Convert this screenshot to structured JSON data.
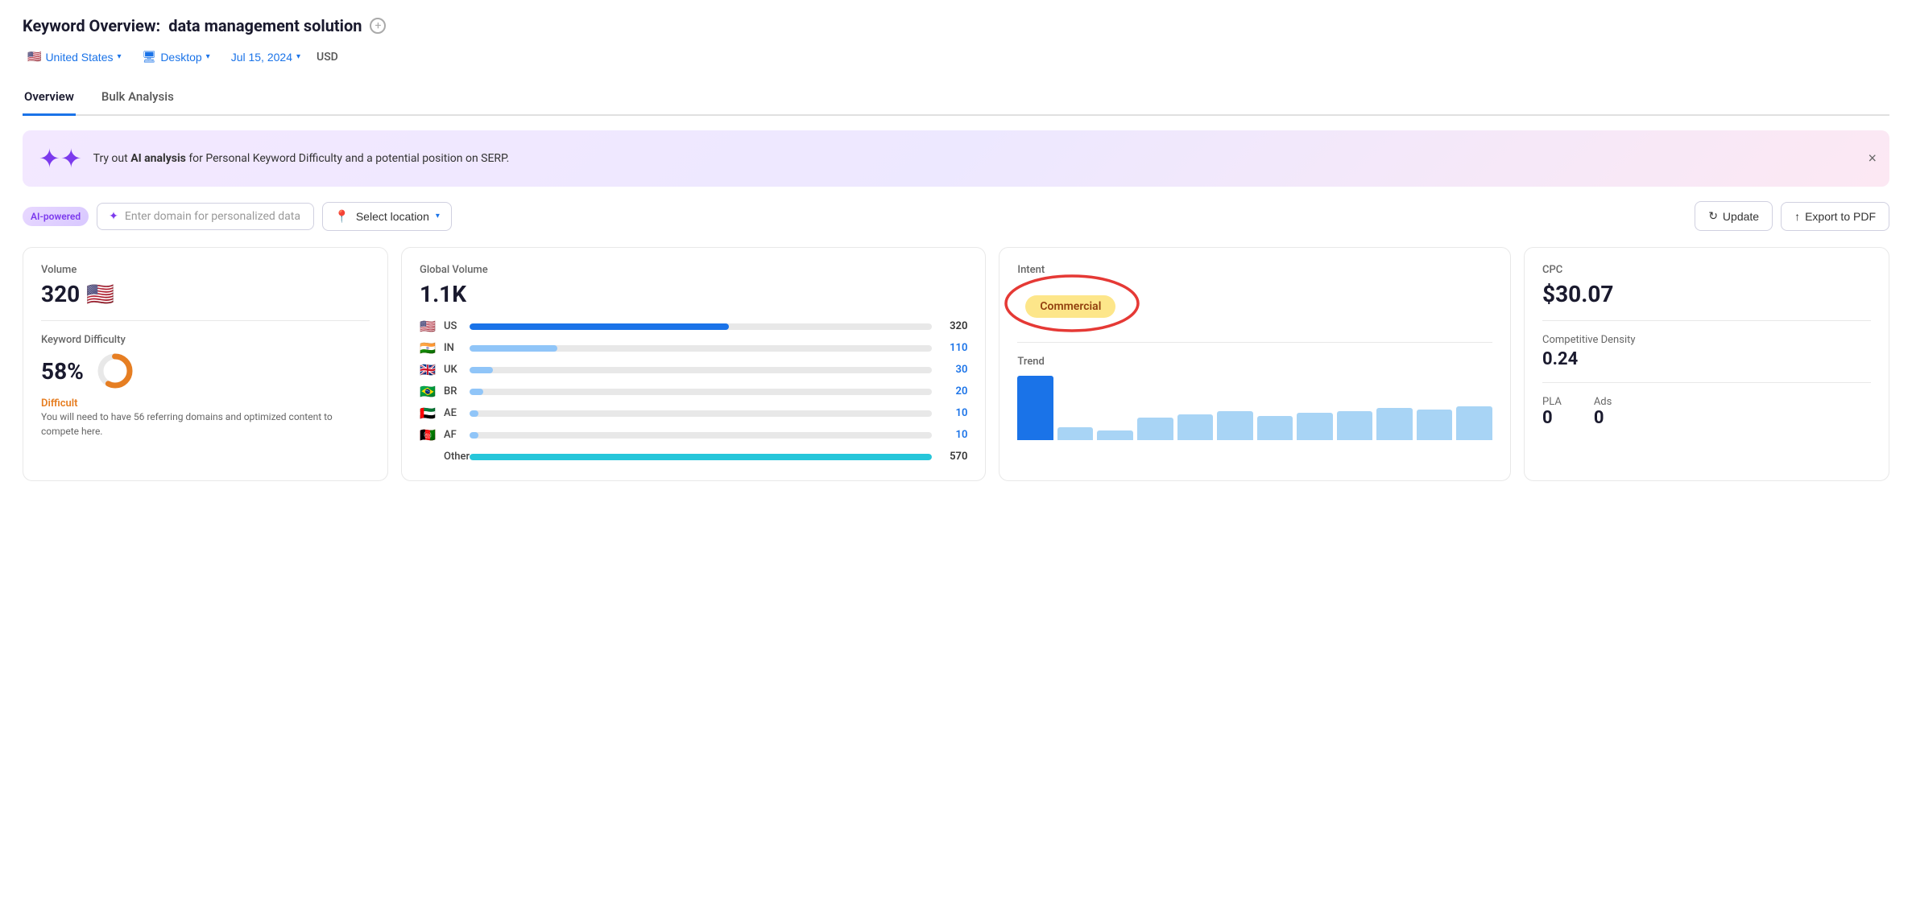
{
  "header": {
    "prefix": "Keyword Overview:",
    "keyword": "data management solution",
    "plus_icon": "+"
  },
  "filters": {
    "country": {
      "flag": "🇺🇸",
      "label": "United States"
    },
    "device": {
      "icon": "🖥",
      "label": "Desktop"
    },
    "date": {
      "label": "Jul 15, 2024"
    },
    "currency": "USD"
  },
  "tabs": [
    {
      "label": "Overview",
      "active": true
    },
    {
      "label": "Bulk Analysis",
      "active": false
    }
  ],
  "ai_banner": {
    "text_before": "Try out ",
    "text_bold": "AI analysis",
    "text_after": " for Personal Keyword Difficulty and a potential position on SERP.",
    "close": "×"
  },
  "ai_controls": {
    "badge": "AI-powered",
    "domain_placeholder": "Enter domain for personalized data",
    "location_label": "Select location",
    "update_label": "Update",
    "export_label": "Export to PDF"
  },
  "cards": {
    "volume": {
      "label": "Volume",
      "value": "320"
    },
    "keyword_difficulty": {
      "label": "Keyword Difficulty",
      "value": "58%",
      "difficulty_label": "Difficult",
      "percent": 58,
      "description": "You will need to have 56 referring domains and optimized content to compete here."
    },
    "global_volume": {
      "label": "Global Volume",
      "value": "1.1K",
      "countries": [
        {
          "flag": "🇺🇸",
          "code": "US",
          "bar_pct": 56,
          "count": "320",
          "bar_type": "blue"
        },
        {
          "flag": "🇮🇳",
          "code": "IN",
          "bar_pct": 19,
          "count": "110",
          "bar_type": "light-blue"
        },
        {
          "flag": "🇬🇧",
          "code": "UK",
          "bar_pct": 5,
          "count": "30",
          "bar_type": "light-blue"
        },
        {
          "flag": "🇧🇷",
          "code": "BR",
          "bar_pct": 3,
          "count": "20",
          "bar_type": "light-blue"
        },
        {
          "flag": "🇦🇪",
          "code": "AE",
          "bar_pct": 2,
          "count": "10",
          "bar_type": "light-blue"
        },
        {
          "flag": "🇦🇫",
          "code": "AF",
          "bar_pct": 2,
          "count": "10",
          "bar_type": "light-blue"
        }
      ],
      "other_label": "Other",
      "other_bar_pct": 100,
      "other_count": "570",
      "other_bar_type": "cyan"
    },
    "intent": {
      "label": "Intent",
      "badge": "Commercial"
    },
    "trend": {
      "label": "Trend",
      "bars": [
        100,
        20,
        15,
        35,
        40,
        45,
        38,
        42,
        45,
        50,
        48,
        52
      ]
    },
    "cpc": {
      "label": "CPC",
      "value": "$30.07"
    },
    "competitive_density": {
      "label": "Competitive Density",
      "value": "0.24"
    },
    "pla": {
      "label": "PLA",
      "value": "0"
    },
    "ads": {
      "label": "Ads",
      "value": "0"
    }
  }
}
